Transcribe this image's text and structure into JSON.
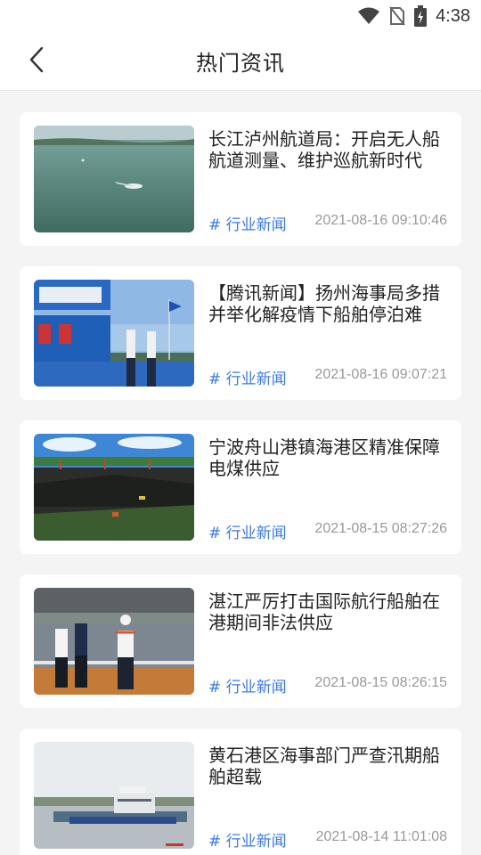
{
  "status_bar": {
    "time": "4:38"
  },
  "header": {
    "title": "热门资讯"
  },
  "articles": [
    {
      "title": "长江泸州航道局：开启无人船航道测量、维护巡航新时代",
      "tag": "# 行业新闻",
      "date": "2021-08-16 09:10:46"
    },
    {
      "title": "【腾讯新闻】扬州海事局多措并举化解疫情下船舶停泊难",
      "tag": "# 行业新闻",
      "date": "2021-08-16 09:07:21"
    },
    {
      "title": "宁波舟山港镇海港区精准保障电煤供应",
      "tag": "# 行业新闻",
      "date": "2021-08-15 08:27:26"
    },
    {
      "title": "湛江严厉打击国际航行船舶在港期间非法供应",
      "tag": "# 行业新闻",
      "date": "2021-08-15 08:26:15"
    },
    {
      "title": "黄石港区海事部门严查汛期船舶超载",
      "tag": "# 行业新闻",
      "date": "2021-08-14 11:01:08"
    }
  ]
}
